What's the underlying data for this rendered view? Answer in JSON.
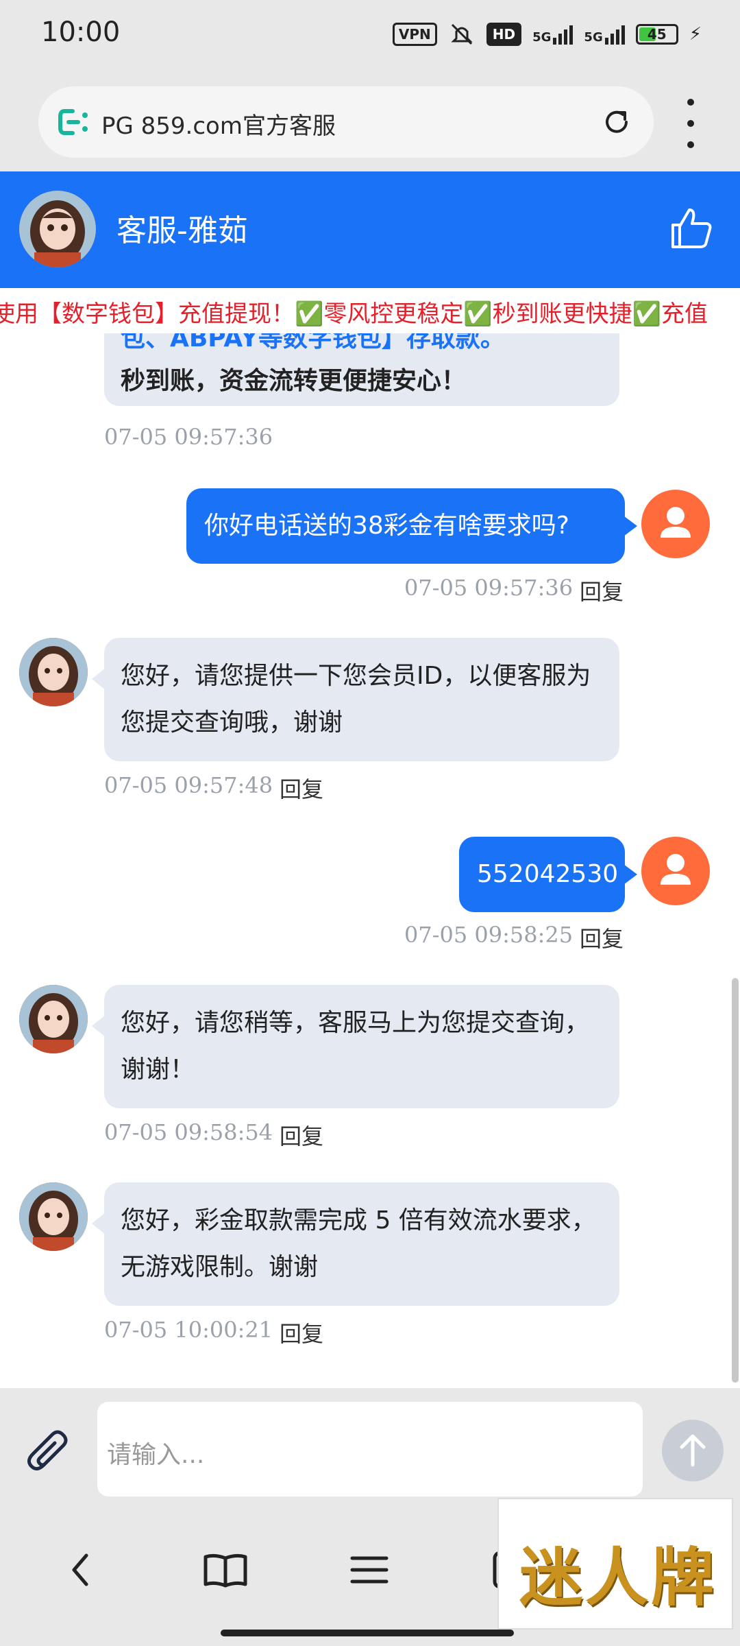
{
  "status_bar": {
    "time": "10:00",
    "vpn": "VPN",
    "hd": "HD",
    "sig1": "5G",
    "sig2": "5G",
    "battery": "45",
    "battery_level": 0.45
  },
  "browser": {
    "url": "PG 859.com官方客服",
    "reload_icon": "reload-icon",
    "menu_icon": "more-vert-icon"
  },
  "chat_header": {
    "title": "客服-雅茹",
    "like_icon": "thumbs-up-icon"
  },
  "marquee": {
    "text_a": "使用【数字钱包】充值提现！",
    "text_b": "零风控更稳定",
    "text_c": "秒到账更快捷",
    "text_d": "充值",
    "check": "✅"
  },
  "messages": {
    "partial_top": "包、ABPAY等数字钱包】存取款。",
    "partial_bold": "秒到账，资金流转更便捷安心！",
    "partial_ts": "07-05 09:57:36",
    "m1": {
      "text": "你好电话送的38彩金有啥要求吗?",
      "ts": "07-05 09:57:36",
      "reply": "回复"
    },
    "m2": {
      "text": "您好，请您提供一下您会员ID，以便客服为您提交查询哦，谢谢",
      "ts": "07-05 09:57:48",
      "reply": "回复"
    },
    "m3": {
      "text": "552042530",
      "ts": "07-05 09:58:25",
      "reply": "回复"
    },
    "m4": {
      "text": "您好，请您稍等，客服马上为您提交查询，谢谢！",
      "ts": "07-05 09:58:54",
      "reply": "回复"
    },
    "m5": {
      "text": "您好，彩金取款需完成 5 倍有效流水要求，无游戏限制。谢谢",
      "ts": "07-05 10:00:21",
      "reply": "回复"
    }
  },
  "input": {
    "placeholder": "请输入..."
  },
  "watermark": "迷人牌",
  "colors": {
    "accent": "#1a73f7",
    "user_avatar": "#ff6b3a",
    "bubble_in": "#e4e9f2"
  }
}
